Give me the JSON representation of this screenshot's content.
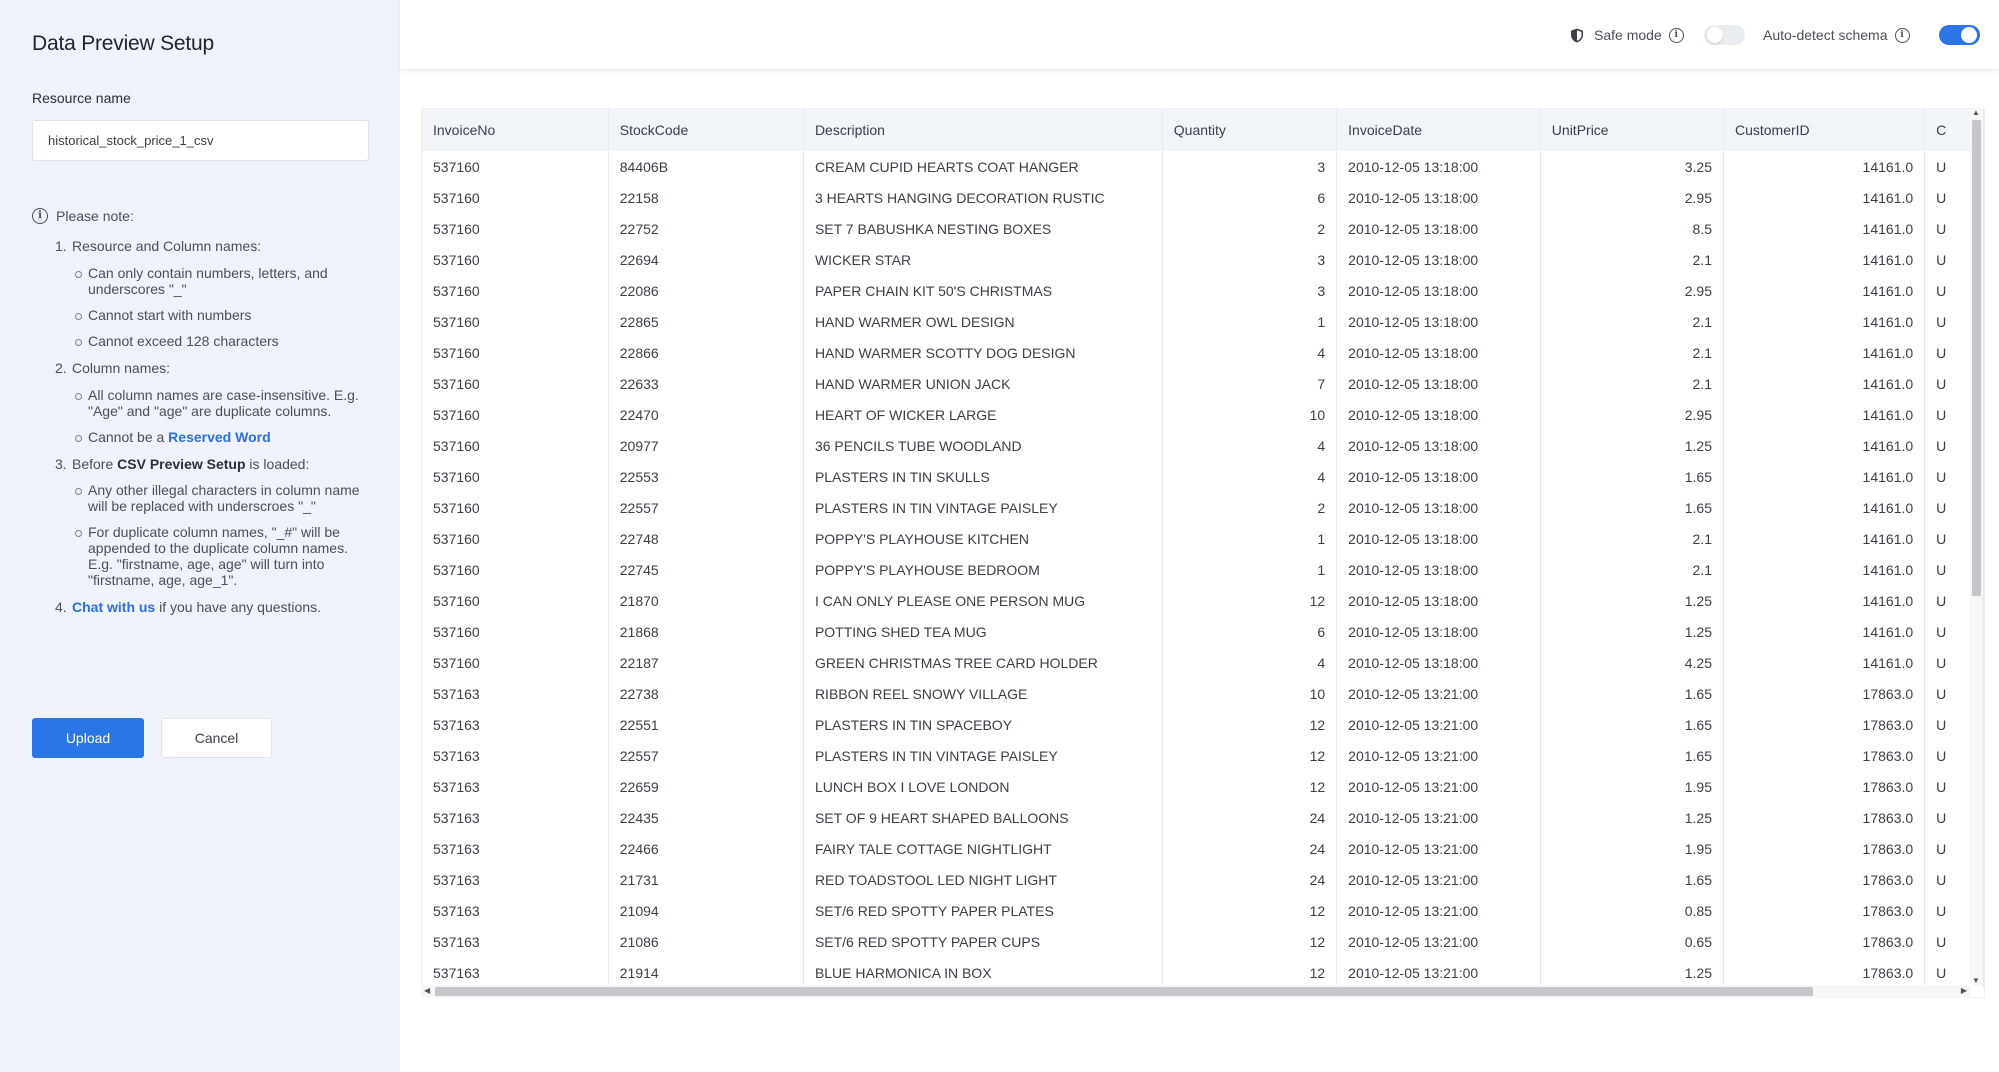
{
  "sidebar": {
    "title": "Data Preview Setup",
    "resource_label": "Resource name",
    "resource_value": "historical_stock_price_1_csv",
    "note_title": "Please note:",
    "item1": "Resource and Column names:",
    "item1_sub1": "Can only contain numbers, letters, and underscores \"_\"",
    "item1_sub2": "Cannot start with numbers",
    "item1_sub3": "Cannot exceed 128 characters",
    "item2": "Column names:",
    "item2_sub1": "All column names are case-insensitive. E.g. \"Age\" and \"age\" are duplicate columns.",
    "item2_sub2_prefix": "Cannot be a ",
    "item2_sub2_link": "Reserved Word",
    "item3_prefix": "Before ",
    "item3_bold": "CSV Preview Setup",
    "item3_suffix": " is loaded:",
    "item3_sub1": "Any other illegal characters in column name will be replaced with underscroes \"_\"",
    "item3_sub2": "For duplicate column names, \"_#\" will be appended to the duplicate column names. E.g. \"firstname, age, age\" will turn into \"firstname, age, age_1\".",
    "item4_link": "Chat with us",
    "item4_suffix": " if you have any questions.",
    "upload_label": "Upload",
    "cancel_label": "Cancel"
  },
  "topbar": {
    "safe_mode_label": "Safe mode",
    "safe_mode_on": false,
    "auto_detect_label": "Auto-detect schema",
    "auto_detect_on": true
  },
  "table": {
    "columns": [
      "InvoiceNo",
      "StockCode",
      "Description",
      "Quantity",
      "InvoiceDate",
      "UnitPrice",
      "CustomerID",
      "C"
    ],
    "rows": [
      [
        "537160",
        "84406B",
        "CREAM CUPID HEARTS COAT HANGER",
        "3",
        "2010-12-05 13:18:00",
        "3.25",
        "14161.0",
        "U"
      ],
      [
        "537160",
        "22158",
        "3 HEARTS HANGING DECORATION RUSTIC",
        "6",
        "2010-12-05 13:18:00",
        "2.95",
        "14161.0",
        "U"
      ],
      [
        "537160",
        "22752",
        "SET 7 BABUSHKA NESTING BOXES",
        "2",
        "2010-12-05 13:18:00",
        "8.5",
        "14161.0",
        "U"
      ],
      [
        "537160",
        "22694",
        "WICKER STAR",
        "3",
        "2010-12-05 13:18:00",
        "2.1",
        "14161.0",
        "U"
      ],
      [
        "537160",
        "22086",
        "PAPER CHAIN KIT 50'S CHRISTMAS",
        "3",
        "2010-12-05 13:18:00",
        "2.95",
        "14161.0",
        "U"
      ],
      [
        "537160",
        "22865",
        "HAND WARMER OWL DESIGN",
        "1",
        "2010-12-05 13:18:00",
        "2.1",
        "14161.0",
        "U"
      ],
      [
        "537160",
        "22866",
        "HAND WARMER SCOTTY DOG DESIGN",
        "4",
        "2010-12-05 13:18:00",
        "2.1",
        "14161.0",
        "U"
      ],
      [
        "537160",
        "22633",
        "HAND WARMER UNION JACK",
        "7",
        "2010-12-05 13:18:00",
        "2.1",
        "14161.0",
        "U"
      ],
      [
        "537160",
        "22470",
        "HEART OF WICKER LARGE",
        "10",
        "2010-12-05 13:18:00",
        "2.95",
        "14161.0",
        "U"
      ],
      [
        "537160",
        "20977",
        "36 PENCILS TUBE WOODLAND",
        "4",
        "2010-12-05 13:18:00",
        "1.25",
        "14161.0",
        "U"
      ],
      [
        "537160",
        "22553",
        "PLASTERS IN TIN SKULLS",
        "4",
        "2010-12-05 13:18:00",
        "1.65",
        "14161.0",
        "U"
      ],
      [
        "537160",
        "22557",
        "PLASTERS IN TIN VINTAGE PAISLEY",
        "2",
        "2010-12-05 13:18:00",
        "1.65",
        "14161.0",
        "U"
      ],
      [
        "537160",
        "22748",
        "POPPY'S PLAYHOUSE KITCHEN",
        "1",
        "2010-12-05 13:18:00",
        "2.1",
        "14161.0",
        "U"
      ],
      [
        "537160",
        "22745",
        "POPPY'S PLAYHOUSE BEDROOM",
        "1",
        "2010-12-05 13:18:00",
        "2.1",
        "14161.0",
        "U"
      ],
      [
        "537160",
        "21870",
        "I CAN ONLY PLEASE ONE PERSON MUG",
        "12",
        "2010-12-05 13:18:00",
        "1.25",
        "14161.0",
        "U"
      ],
      [
        "537160",
        "21868",
        "POTTING SHED TEA MUG",
        "6",
        "2010-12-05 13:18:00",
        "1.25",
        "14161.0",
        "U"
      ],
      [
        "537160",
        "22187",
        "GREEN CHRISTMAS TREE CARD HOLDER",
        "4",
        "2010-12-05 13:18:00",
        "4.25",
        "14161.0",
        "U"
      ],
      [
        "537163",
        "22738",
        "RIBBON REEL SNOWY VILLAGE",
        "10",
        "2010-12-05 13:21:00",
        "1.65",
        "17863.0",
        "U"
      ],
      [
        "537163",
        "22551",
        "PLASTERS IN TIN SPACEBOY",
        "12",
        "2010-12-05 13:21:00",
        "1.65",
        "17863.0",
        "U"
      ],
      [
        "537163",
        "22557",
        "PLASTERS IN TIN VINTAGE PAISLEY",
        "12",
        "2010-12-05 13:21:00",
        "1.65",
        "17863.0",
        "U"
      ],
      [
        "537163",
        "22659",
        "LUNCH BOX I LOVE LONDON",
        "12",
        "2010-12-05 13:21:00",
        "1.95",
        "17863.0",
        "U"
      ],
      [
        "537163",
        "22435",
        "SET OF 9 HEART SHAPED BALLOONS",
        "24",
        "2010-12-05 13:21:00",
        "1.25",
        "17863.0",
        "U"
      ],
      [
        "537163",
        "22466",
        "FAIRY TALE COTTAGE NIGHTLIGHT",
        "24",
        "2010-12-05 13:21:00",
        "1.95",
        "17863.0",
        "U"
      ],
      [
        "537163",
        "21731",
        "RED TOADSTOOL LED NIGHT LIGHT",
        "24",
        "2010-12-05 13:21:00",
        "1.65",
        "17863.0",
        "U"
      ],
      [
        "537163",
        "21094",
        "SET/6 RED SPOTTY PAPER PLATES",
        "12",
        "2010-12-05 13:21:00",
        "0.85",
        "17863.0",
        "U"
      ],
      [
        "537163",
        "21086",
        "SET/6 RED SPOTTY PAPER CUPS",
        "12",
        "2010-12-05 13:21:00",
        "0.65",
        "17863.0",
        "U"
      ],
      [
        "537163",
        "21914",
        "BLUE HARMONICA IN BOX",
        "12",
        "2010-12-05 13:21:00",
        "1.25",
        "17863.0",
        "U"
      ]
    ]
  }
}
